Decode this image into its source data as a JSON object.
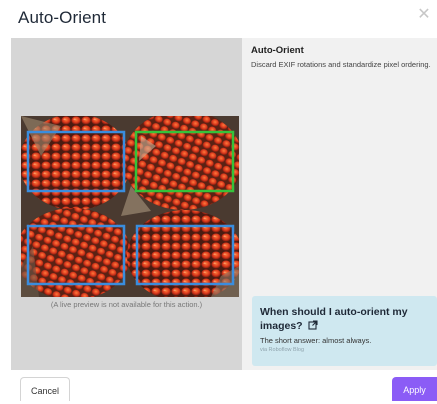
{
  "dialog": {
    "title": "Auto-Orient",
    "close_symbol": "✕"
  },
  "preview": {
    "note": "(A live preview is not available for this action.)",
    "boxes": [
      {
        "label": "box-top-left",
        "color": "#3a8dde"
      },
      {
        "label": "box-top-right",
        "color": "#35c23a"
      },
      {
        "label": "box-bottom-left",
        "color": "#3a8dde"
      },
      {
        "label": "box-bottom-right",
        "color": "#3a8dde"
      }
    ]
  },
  "details": {
    "title": "Auto-Orient",
    "description": "Discard EXIF rotations and standardize pixel ordering."
  },
  "info": {
    "title": "When should I auto-orient my images?",
    "icon": "external-link-icon",
    "text": "The short answer: almost always.",
    "link": "via Roboflow Blog"
  },
  "footer": {
    "cancel_label": "Cancel",
    "apply_label": "Apply"
  },
  "colors": {
    "accent": "#8b5cf6",
    "info_bg": "#cfe8f0",
    "box_blue": "#3a8dde",
    "box_green": "#35c23a"
  }
}
